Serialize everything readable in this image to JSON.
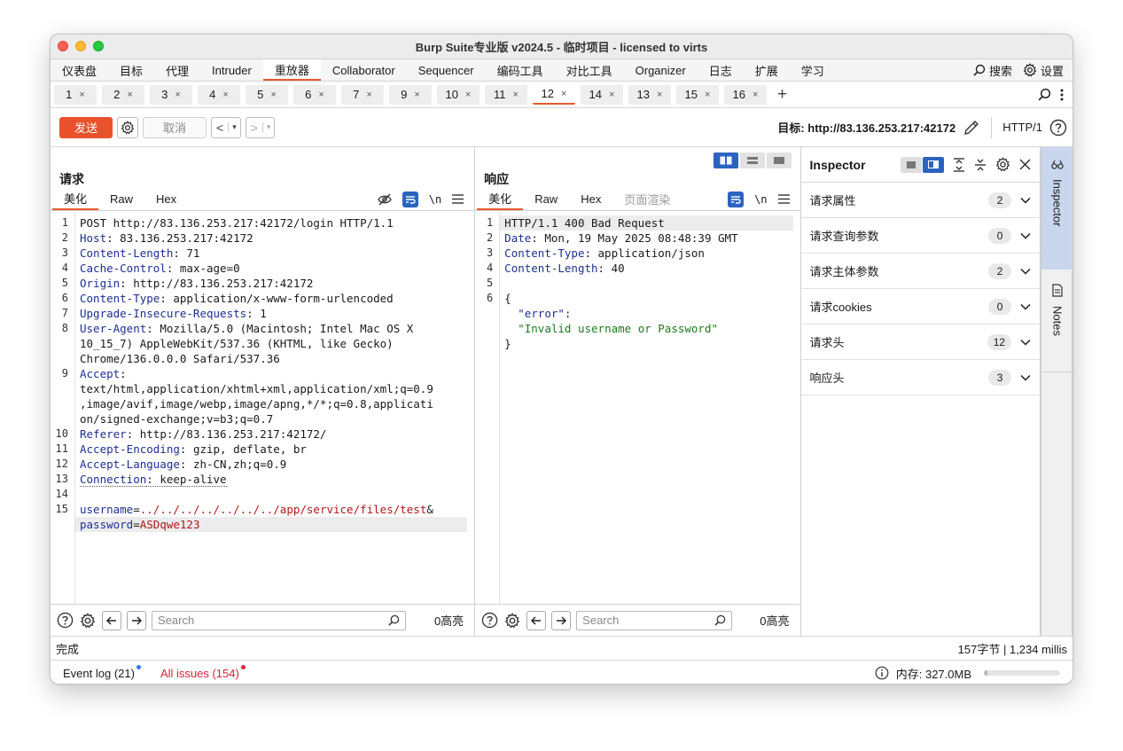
{
  "window": {
    "title": "Burp Suite专业版  v2024.5 - 临时项目 - licensed to virts"
  },
  "menu": {
    "items": [
      "仪表盘",
      "目标",
      "代理",
      "Intruder",
      "重放器",
      "Collaborator",
      "Sequencer",
      "编码工具",
      "对比工具",
      "Organizer",
      "日志",
      "扩展",
      "学习"
    ],
    "active_index": 4,
    "search_label": "搜索",
    "settings_label": "设置"
  },
  "repeater_tabs": {
    "items": [
      "1",
      "2",
      "3",
      "4",
      "5",
      "6",
      "7",
      "9",
      "10",
      "11",
      "12",
      "14",
      "13",
      "15",
      "16"
    ],
    "active_index": 10,
    "close_glyph": "×",
    "add_glyph": "+"
  },
  "toolbar": {
    "send_label": "发送",
    "cancel_label": "取消",
    "back_glyph": "<",
    "forward_glyph": ">",
    "dropdown_glyph": "▾",
    "target_label": "目标: http://83.136.253.217:42172",
    "http_version": "HTTP/1"
  },
  "request": {
    "title": "请求",
    "tabs": [
      "美化",
      "Raw",
      "Hex"
    ],
    "active_tab": 0,
    "newline_label": "\\n",
    "lines": [
      {
        "num": "1",
        "rows": [
          {
            "parts": [
              {
                "t": "POST http://83.136.253.217:42172/login HTTP/1.1",
                "c": "v"
              }
            ]
          }
        ]
      },
      {
        "num": "2",
        "rows": [
          {
            "parts": [
              {
                "t": "Host",
                "c": "k"
              },
              {
                "t": ": 83.136.253.217:42172",
                "c": "v"
              }
            ]
          }
        ]
      },
      {
        "num": "3",
        "rows": [
          {
            "parts": [
              {
                "t": "Content-Length",
                "c": "k"
              },
              {
                "t": ": 71",
                "c": "v"
              }
            ]
          }
        ]
      },
      {
        "num": "4",
        "rows": [
          {
            "parts": [
              {
                "t": "Cache-Control",
                "c": "k"
              },
              {
                "t": ": max-age=0",
                "c": "v"
              }
            ]
          }
        ]
      },
      {
        "num": "5",
        "rows": [
          {
            "parts": [
              {
                "t": "Origin",
                "c": "k"
              },
              {
                "t": ": http://83.136.253.217:42172",
                "c": "v"
              }
            ]
          }
        ]
      },
      {
        "num": "6",
        "rows": [
          {
            "parts": [
              {
                "t": "Content-Type",
                "c": "k"
              },
              {
                "t": ": application/x-www-form-urlencoded",
                "c": "v"
              }
            ]
          }
        ]
      },
      {
        "num": "7",
        "rows": [
          {
            "parts": [
              {
                "t": "Upgrade-Insecure-Requests",
                "c": "k"
              },
              {
                "t": ": 1",
                "c": "v"
              }
            ]
          }
        ]
      },
      {
        "num": "8",
        "rows": [
          {
            "parts": [
              {
                "t": "User-Agent",
                "c": "k"
              },
              {
                "t": ": Mozilla/5.0 (Macintosh; Intel Mac OS X",
                "c": "v"
              }
            ]
          },
          {
            "parts": [
              {
                "t": "10_15_7) AppleWebKit/537.36 (KHTML, like Gecko)",
                "c": "v"
              }
            ]
          },
          {
            "parts": [
              {
                "t": "Chrome/136.0.0.0 Safari/537.36",
                "c": "v"
              }
            ]
          }
        ]
      },
      {
        "num": "9",
        "rows": [
          {
            "parts": [
              {
                "t": "Accept",
                "c": "k"
              },
              {
                "t": ":",
                "c": "v"
              }
            ]
          },
          {
            "parts": [
              {
                "t": "text/html,application/xhtml+xml,application/xml;q=0.9",
                "c": "v"
              }
            ]
          },
          {
            "parts": [
              {
                "t": ",image/avif,image/webp,image/apng,*/*;q=0.8,applicati",
                "c": "v"
              }
            ]
          },
          {
            "parts": [
              {
                "t": "on/signed-exchange;v=b3;q=0.7",
                "c": "v"
              }
            ]
          }
        ]
      },
      {
        "num": "10",
        "rows": [
          {
            "parts": [
              {
                "t": "Referer",
                "c": "k"
              },
              {
                "t": ": http://83.136.253.217:42172/",
                "c": "v"
              }
            ]
          }
        ]
      },
      {
        "num": "11",
        "rows": [
          {
            "parts": [
              {
                "t": "Accept-Encoding",
                "c": "k"
              },
              {
                "t": ": gzip, deflate, br",
                "c": "v"
              }
            ]
          }
        ]
      },
      {
        "num": "12",
        "rows": [
          {
            "parts": [
              {
                "t": "Accept-Language",
                "c": "k"
              },
              {
                "t": ": zh-CN,zh;q=0.9",
                "c": "v"
              }
            ]
          }
        ]
      },
      {
        "num": "13",
        "rows": [
          {
            "parts": [
              {
                "t": "Connection",
                "c": "k dotted"
              },
              {
                "t": ": keep-alive",
                "c": "v dotted"
              }
            ]
          }
        ]
      },
      {
        "num": "14",
        "rows": [
          {
            "parts": [
              {
                "t": "",
                "c": "v"
              }
            ]
          }
        ]
      },
      {
        "num": "15",
        "rows": [
          {
            "parts": [
              {
                "t": "username",
                "c": "pk"
              },
              {
                "t": "=",
                "c": "v"
              },
              {
                "t": "../../../../../../../app/service/files/test",
                "c": "pv"
              },
              {
                "t": "&",
                "c": "v"
              }
            ]
          },
          {
            "hl": true,
            "parts": [
              {
                "t": "password",
                "c": "pk"
              },
              {
                "t": "=",
                "c": "v"
              },
              {
                "t": "ASDqwe123",
                "c": "pv"
              }
            ]
          }
        ]
      }
    ],
    "search_placeholder": "Search",
    "highlight_count": "0高亮"
  },
  "response": {
    "title": "响应",
    "tabs": [
      "美化",
      "Raw",
      "Hex",
      "页面渲染"
    ],
    "active_tab": 0,
    "newline_label": "\\n",
    "lines": [
      {
        "num": "1",
        "rows": [
          {
            "hl": true,
            "parts": [
              {
                "t": "HTTP/1.1 400 Bad Request",
                "c": "v"
              }
            ]
          }
        ]
      },
      {
        "num": "2",
        "rows": [
          {
            "parts": [
              {
                "t": "Date",
                "c": "k"
              },
              {
                "t": ": Mon, 19 May 2025 08:48:39 GMT",
                "c": "v"
              }
            ]
          }
        ]
      },
      {
        "num": "3",
        "rows": [
          {
            "parts": [
              {
                "t": "Content-Type",
                "c": "k"
              },
              {
                "t": ": application/json",
                "c": "v"
              }
            ]
          }
        ]
      },
      {
        "num": "4",
        "rows": [
          {
            "parts": [
              {
                "t": "Content-Length",
                "c": "k"
              },
              {
                "t": ": 40",
                "c": "v"
              }
            ]
          }
        ]
      },
      {
        "num": "5",
        "rows": [
          {
            "parts": [
              {
                "t": "",
                "c": "v"
              }
            ]
          }
        ]
      },
      {
        "num": "6",
        "rows": [
          {
            "parts": [
              {
                "t": "{",
                "c": "v"
              }
            ]
          },
          {
            "parts": [
              {
                "t": "  ",
                "c": "v"
              },
              {
                "t": "\"error\"",
                "c": "jk"
              },
              {
                "t": ":",
                "c": "v"
              }
            ]
          },
          {
            "parts": [
              {
                "t": "  ",
                "c": "v"
              },
              {
                "t": "\"Invalid username or Password\"",
                "c": "js"
              }
            ]
          },
          {
            "parts": [
              {
                "t": "}",
                "c": "v"
              }
            ]
          }
        ]
      }
    ],
    "search_placeholder": "Search",
    "highlight_count": "0高亮"
  },
  "inspector": {
    "title": "Inspector",
    "rows": [
      {
        "label": "请求属性",
        "count": "2"
      },
      {
        "label": "请求查询参数",
        "count": "0"
      },
      {
        "label": "请求主体参数",
        "count": "2"
      },
      {
        "label": "请求cookies",
        "count": "0"
      },
      {
        "label": "请求头",
        "count": "12"
      },
      {
        "label": "响应头",
        "count": "3"
      }
    ]
  },
  "side_panel": {
    "inspector_label": "Inspector",
    "notes_label": "Notes"
  },
  "status": {
    "left": "完成",
    "right": "157字节 | 1,234 millis"
  },
  "footer": {
    "event_log": "Event log (21)",
    "all_issues": "All issues (154)",
    "memory": "内存: 327.0MB",
    "memory_fraction": 0.05
  },
  "colors": {
    "accent": "#e8582c",
    "send": "#e8522c",
    "blue": "#2b63c1",
    "issues": "#d2233b"
  }
}
